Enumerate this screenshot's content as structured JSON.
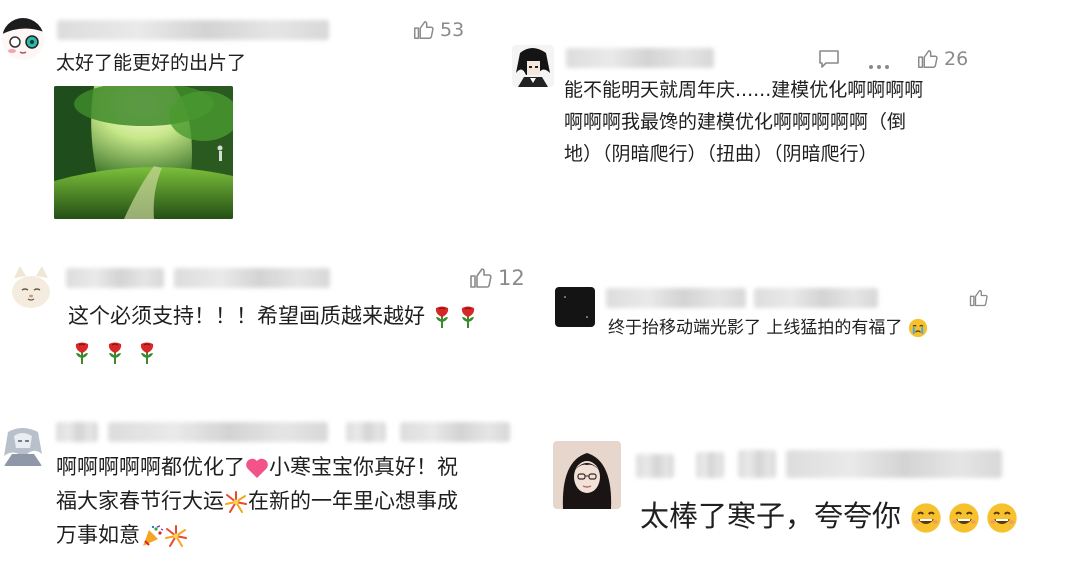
{
  "comments": [
    {
      "likes": "53",
      "lines": [
        "太好了能更好的出片了"
      ]
    },
    {
      "likes": "26",
      "lines": [
        "能不能明天就周年庆......建模优化啊啊啊啊",
        "啊啊啊我最馋的建模优化啊啊啊啊啊（倒",
        "地）（阴暗爬行）（扭曲）（阴暗爬行）"
      ]
    },
    {
      "likes": "12",
      "lines": [
        "这个必须支持！！！希望画质越来越好"
      ]
    },
    {
      "likes": "",
      "lines": [
        "终于抬移动端光影了 上线猛拍的有福了"
      ]
    },
    {
      "likes": "",
      "lines": [
        "啊啊啊啊啊都优化了",
        "小寒宝宝你真好！祝",
        "福大家春节行大运",
        "在新的一年里心想事成",
        "万事如意"
      ]
    },
    {
      "likes": "",
      "lines": [
        "太棒了寒子，夸夸你"
      ]
    }
  ],
  "icons": {
    "like": "thumbs-up-icon",
    "reply": "comment-icon",
    "more": "more-dots-icon",
    "rose": "rose-emoji",
    "heart": "heart-emoji",
    "firework": "firework-emoji",
    "party": "party-popper-emoji",
    "grin": "grinning-emoji",
    "cry": "crying-emoji"
  },
  "colors": {
    "text": "#1f1f1f",
    "meta": "#8a8a8a",
    "rose": "#d62828",
    "heart": "#f2548a"
  }
}
